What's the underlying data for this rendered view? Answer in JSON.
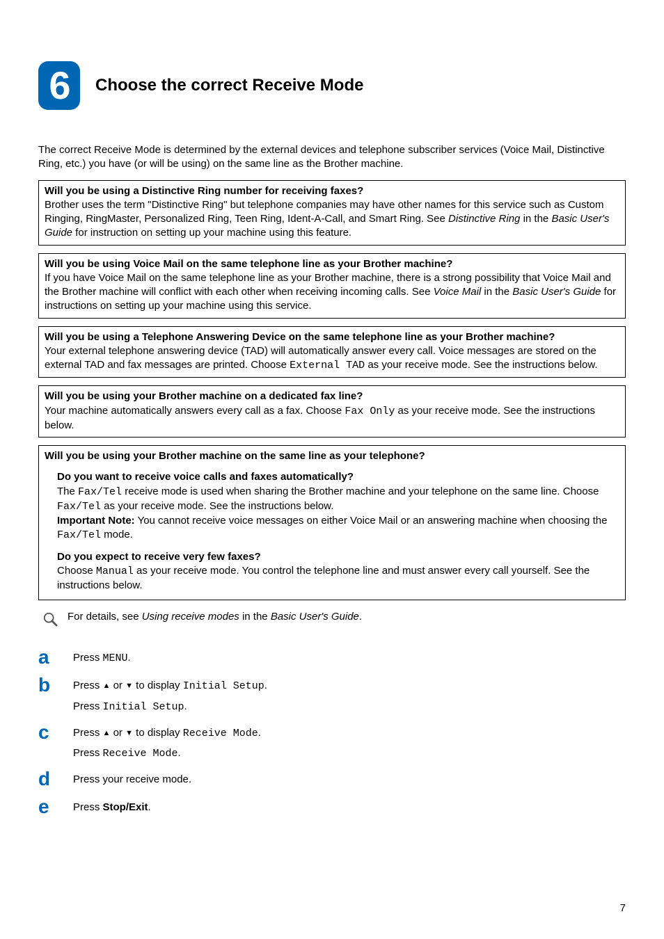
{
  "header": {
    "step_number": "6",
    "title": "Choose the correct Receive Mode"
  },
  "intro": "The correct Receive Mode is determined by the external devices and telephone subscriber services (Voice Mail, Distinctive Ring, etc.) you have (or will be using) on the same line as the Brother machine.",
  "box1": {
    "question": "Will you be using a Distinctive Ring number for receiving faxes?",
    "body_prefix": "Brother uses the term \"Distinctive Ring\" but telephone companies may have other names for this service such as Custom Ringing, RingMaster, Personalized Ring, Teen Ring, Ident-A-Call, and Smart Ring. See ",
    "body_ital1": "Distinctive Ring",
    "body_mid": " in the ",
    "body_ital2": "Basic User's Guide",
    "body_suffix": " for instruction on setting up your machine using this feature."
  },
  "box2": {
    "question": "Will you be using Voice Mail on the same telephone line as your Brother machine?",
    "body_prefix": "If you have Voice Mail on the same telephone line as your Brother machine, there is a strong possibility that Voice Mail and the Brother machine will conflict with each other when receiving incoming calls. See ",
    "body_ital1": "Voice Mail",
    "body_mid": " in the ",
    "body_ital2": "Basic User's Guide",
    "body_suffix": " for instructions on setting up your machine using this service."
  },
  "box3": {
    "question": "Will you be using a Telephone Answering Device on the same telephone line as your Brother machine?",
    "body_prefix": "Your external telephone answering device (TAD) will automatically answer every call. Voice messages are stored on the external TAD and fax messages are printed. Choose ",
    "body_mono": "External TAD",
    "body_suffix": " as your receive mode. See the instructions below."
  },
  "box4": {
    "question": "Will you be using your Brother machine on a dedicated fax line?",
    "body_prefix": "Your machine automatically answers every call as a fax. Choose ",
    "body_mono": "Fax Only",
    "body_suffix": " as your receive mode. See the instructions below."
  },
  "box5": {
    "question": "Will you be using your Brother machine on the same line as your telephone?",
    "sub1": {
      "question": "Do you want to receive voice calls and faxes automatically?",
      "p1_a": "The ",
      "p1_mono1": "Fax/Tel",
      "p1_b": " receive mode is used when sharing the Brother machine and your telephone on the same line. Choose ",
      "p1_mono2": "Fax/Tel",
      "p1_c": " as your receive mode. See the instructions below.",
      "p2_label": "Important Note:",
      "p2_a": " You cannot receive voice messages on either Voice Mail or an answering machine when choosing the ",
      "p2_mono": "Fax/Tel",
      "p2_b": " mode."
    },
    "sub2": {
      "question": "Do you expect to receive very few faxes?",
      "p1_a": "Choose ",
      "p1_mono": "Manual",
      "p1_b": " as your receive mode. You control the telephone line and must answer every call yourself. See the instructions below."
    }
  },
  "note": {
    "prefix": "For details, see ",
    "ital1": "Using receive modes",
    "mid": " in the ",
    "ital2": "Basic User's Guide",
    "suffix": "."
  },
  "steps": {
    "a": {
      "letter": "a",
      "line1_a": "Press ",
      "line1_mono": "MENU",
      "line1_b": "."
    },
    "b": {
      "letter": "b",
      "line1_a": "Press ",
      "line1_b": " or ",
      "line1_c": " to display ",
      "line1_mono": "Initial Setup",
      "line1_d": ".",
      "line2_a": "Press ",
      "line2_mono": "Initial Setup",
      "line2_b": "."
    },
    "c": {
      "letter": "c",
      "line1_a": "Press ",
      "line1_b": " or ",
      "line1_c": " to display ",
      "line1_mono": "Receive Mode",
      "line1_d": ".",
      "line2_a": "Press ",
      "line2_mono": "Receive Mode",
      "line2_b": "."
    },
    "d": {
      "letter": "d",
      "line1": "Press your receive mode."
    },
    "e": {
      "letter": "e",
      "line1_a": "Press ",
      "line1_bold": "Stop/Exit",
      "line1_b": "."
    }
  },
  "page_number": "7",
  "glyphs": {
    "up": "▲",
    "down": "▼"
  }
}
